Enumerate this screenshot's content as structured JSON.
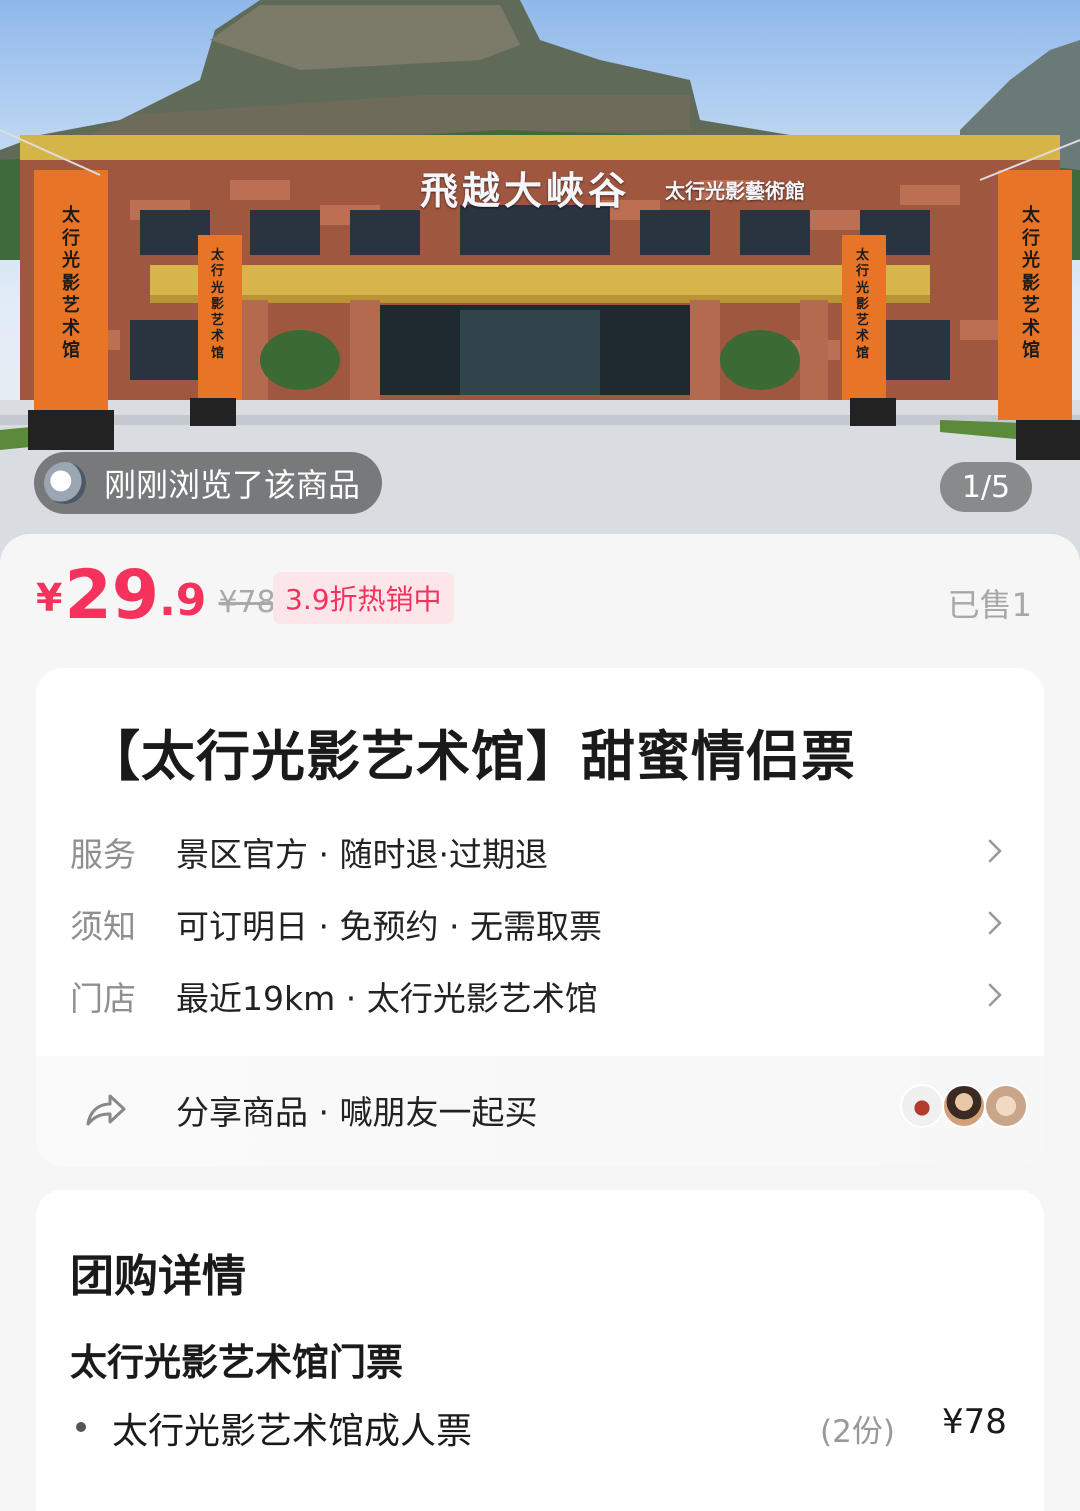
{
  "hero": {
    "signboard": "飛越大峽谷",
    "signboard_sub": "太行光影藝術館",
    "banner_text": "太行光影艺术馆",
    "browsed_badge": "刚刚浏览了该商品",
    "page_indicator": "1/5",
    "total_images": 5,
    "current_image": 1
  },
  "price": {
    "currency": "¥",
    "integer": "29",
    "decimal": ".9",
    "original": "¥78",
    "discount_badge": "3.9折热销中",
    "sold": "已售1"
  },
  "product": {
    "title": "【太行光影艺术馆】甜蜜情侣票",
    "rows": [
      {
        "label": "服务",
        "value": "景区官方 · 随时退·过期退"
      },
      {
        "label": "须知",
        "value": "可订明日 · 免预约 · 无需取票"
      },
      {
        "label": "门店",
        "value": "最近19km · 太行光影艺术馆"
      }
    ],
    "share_text": "分享商品 · 喊朋友一起买"
  },
  "group_detail": {
    "title": "团购详情",
    "ticket_name": "太行光影艺术馆门票",
    "items": [
      {
        "name": "太行光影艺术馆成人票",
        "quantity": "(2份)",
        "price": "¥78"
      }
    ]
  },
  "colors": {
    "accent": "#f5325c",
    "badge_bg": "#fde6ea",
    "muted_text": "#a8a8a8",
    "card_bg": "#ffffff",
    "page_bg": "#f6f6f6"
  },
  "icons": {
    "chevron": "chevron-right-icon",
    "share": "share-arrow-icon"
  }
}
